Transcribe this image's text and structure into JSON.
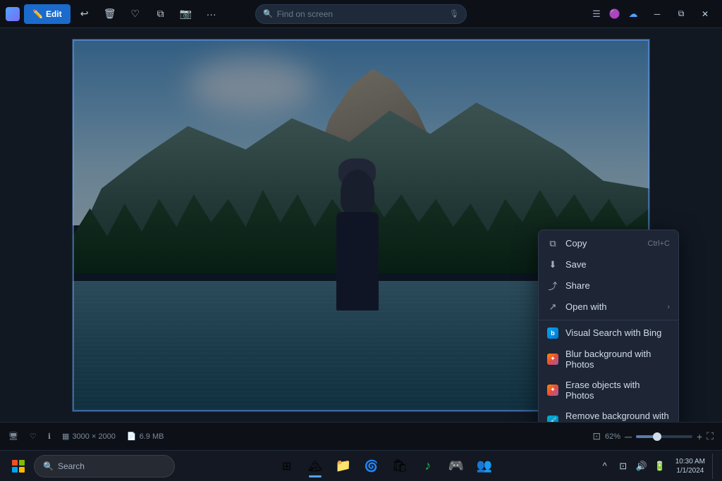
{
  "titlebar": {
    "edit_label": "Edit",
    "search_placeholder": "Find on screen",
    "more_label": "...",
    "tray": {
      "icon1": "🟣",
      "icon2": "☁"
    }
  },
  "toolbar": {
    "buttons": [
      "↩",
      "🗑",
      "⭐",
      "📋",
      "📷",
      "⋯"
    ]
  },
  "context_menu": {
    "items": [
      {
        "id": "copy",
        "label": "Copy",
        "shortcut": "Ctrl+C",
        "icon": "copy"
      },
      {
        "id": "save",
        "label": "Save",
        "shortcut": "",
        "icon": "save"
      },
      {
        "id": "share",
        "label": "Share",
        "shortcut": "",
        "icon": "share"
      },
      {
        "id": "open-with",
        "label": "Open with",
        "shortcut": "",
        "icon": "openwith",
        "arrow": true
      },
      {
        "id": "visual-search",
        "label": "Visual Search with Bing",
        "shortcut": "",
        "icon": "bing"
      },
      {
        "id": "blur-bg",
        "label": "Blur background with Photos",
        "shortcut": "",
        "icon": "photos"
      },
      {
        "id": "erase-objects",
        "label": "Erase objects with Photos",
        "shortcut": "",
        "icon": "photos"
      },
      {
        "id": "remove-bg",
        "label": "Remove background with Paint",
        "shortcut": "",
        "icon": "paint"
      }
    ]
  },
  "status_bar": {
    "dimensions": "3000 × 2000",
    "file_size": "6.9 MB",
    "zoom": "62%"
  },
  "taskbar": {
    "search_placeholder": "Search",
    "apps": [
      {
        "id": "widgets",
        "icon": "🗃️"
      },
      {
        "id": "file-explorer",
        "icon": "📁"
      },
      {
        "id": "edge",
        "icon": "🌐"
      },
      {
        "id": "store",
        "icon": "🛍️"
      },
      {
        "id": "photos",
        "icon": "📷"
      },
      {
        "id": "xbox",
        "icon": "🎮"
      },
      {
        "id": "teams",
        "icon": "💬"
      }
    ],
    "tray": {
      "chevron": "^",
      "network": "🌐",
      "volume": "🔊",
      "battery": "🔋"
    },
    "clock": {
      "time": "10:30 AM",
      "date": "1/1/2024"
    }
  }
}
